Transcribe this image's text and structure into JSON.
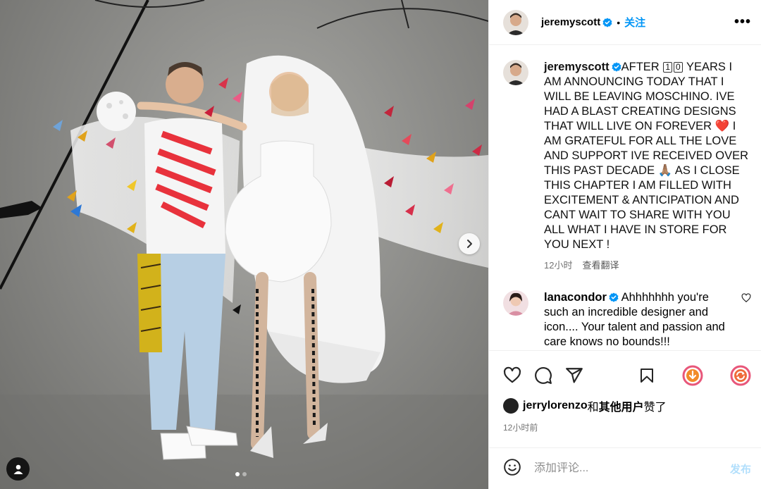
{
  "post": {
    "username": "jeremyscott",
    "follow_label": "关注",
    "separator": "•",
    "more_label": "•••"
  },
  "caption": {
    "username": "jeremyscott",
    "text_before_box": "AFTER ",
    "box_digits": [
      "1",
      "0"
    ],
    "text_1": " YEARS I AM ANNOUNCING TODAY THAT I WILL BE LEAVING MOSCHINO. IVE HAD A BLAST CREATING DESIGNS THAT WILL LIVE ON FOREVER ",
    "emoji_1": "❤️",
    "text_2": " I AM GRATEFUL FOR ALL THE LOVE AND SUPPORT IVE RECEIVED OVER THIS PAST DECADE ",
    "emoji_2": "🙏🏽",
    "text_3": " AS I CLOSE THIS CHAPTER I AM FILLED WITH EXCITEMENT & ANTICIPATION AND CANT WAIT TO SHARE WITH YOU ALL WHAT I HAVE IN STORE FOR YOU NEXT !",
    "time": "12小时",
    "translate_label": "查看翻译"
  },
  "comment": {
    "username": "lanacondor",
    "text": "Ahhhhhhh you're such an incredible designer and icon.... Your talent and passion and care knows no bounds!!!"
  },
  "likes": {
    "first_user": "jerrylorenzo",
    "connector": "和",
    "others": "其他用户",
    "suffix": "赞了"
  },
  "post_time": "12小时前",
  "add_comment": {
    "placeholder": "添加评论...",
    "post_label": "发布"
  },
  "carousel": {
    "total_slides": 2,
    "current_slide": 1
  },
  "colors": {
    "accent": "#0095f6",
    "verified": "#0095f6",
    "post_disabled": "#b2dffc"
  }
}
